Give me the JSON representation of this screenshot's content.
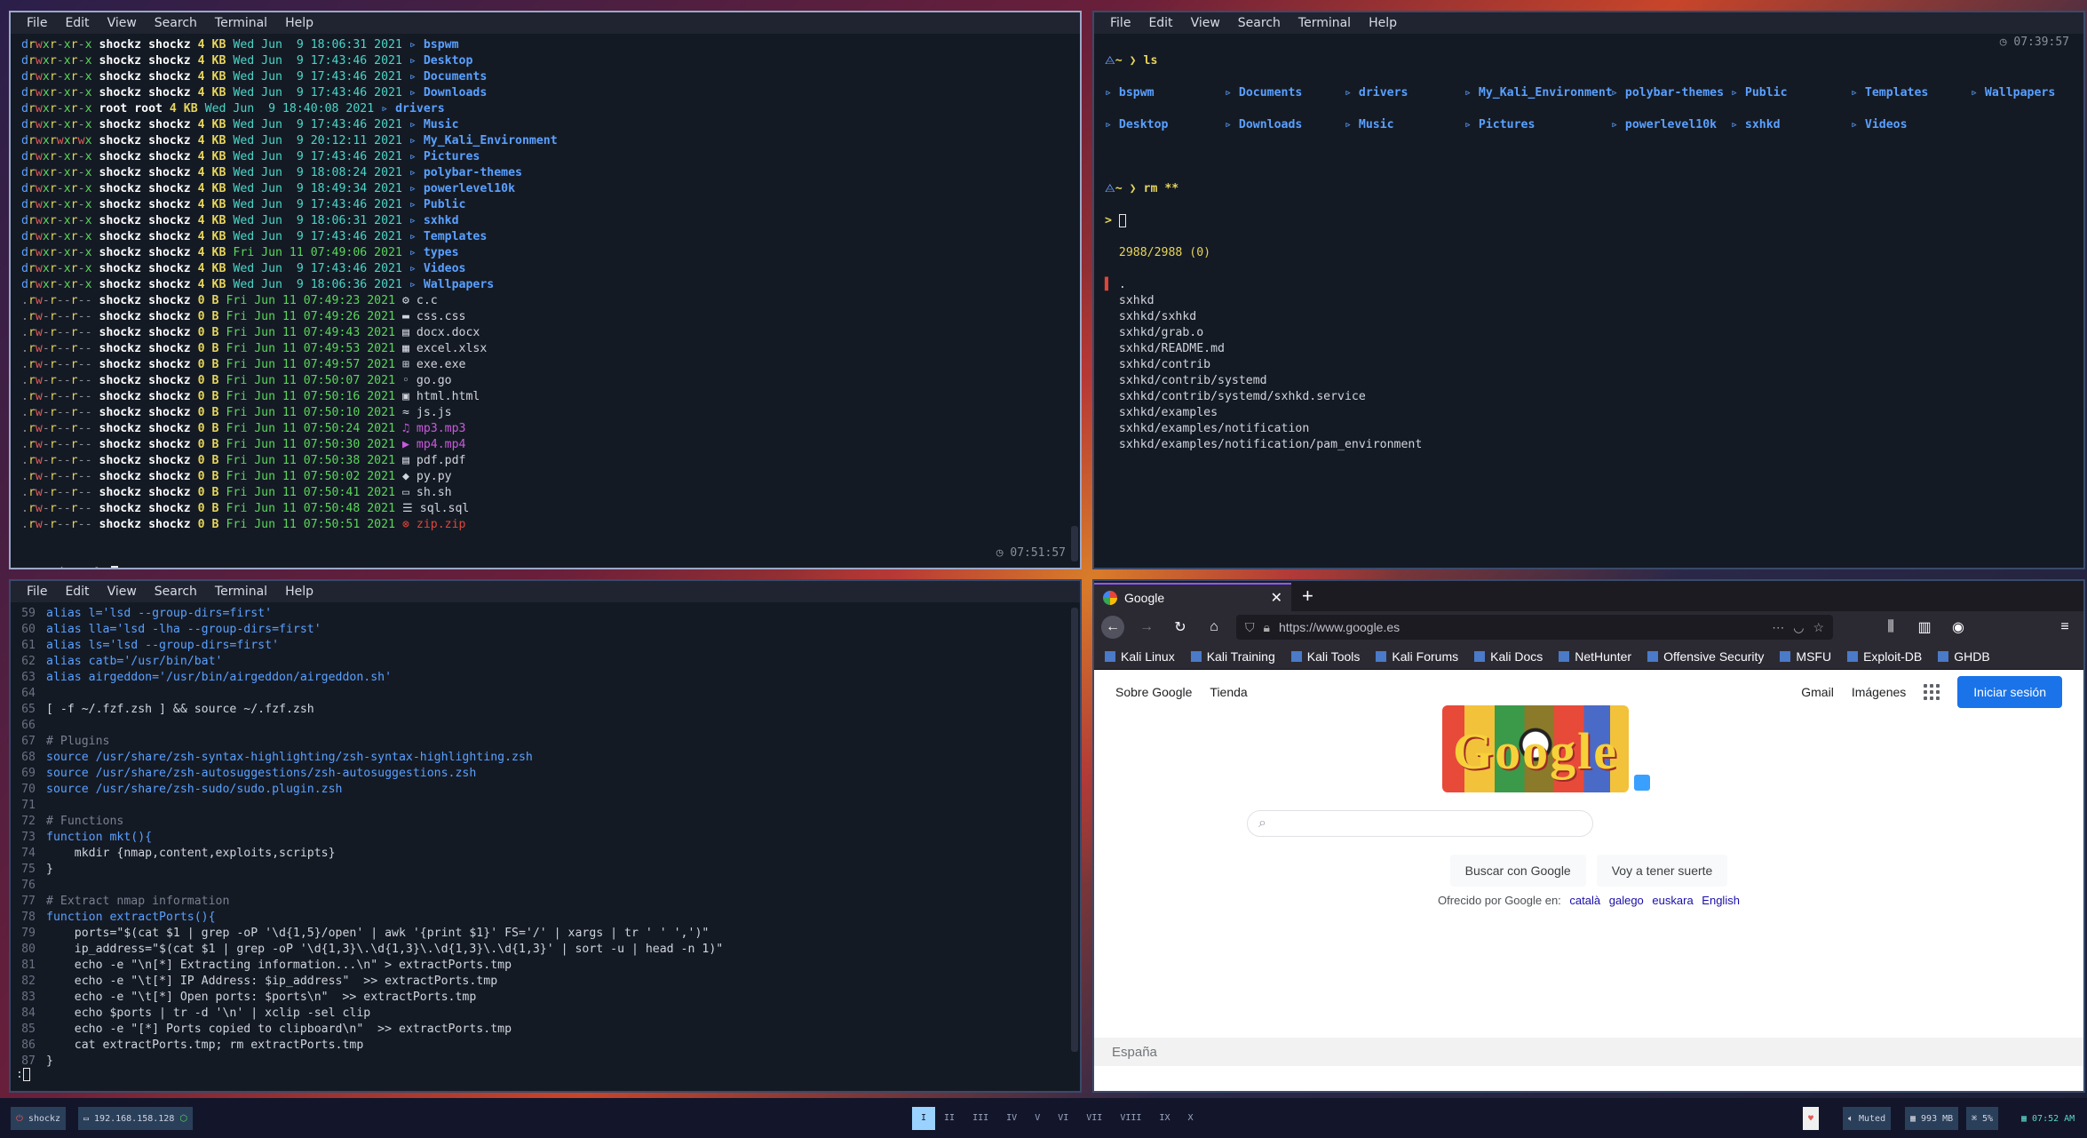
{
  "menus": [
    "File",
    "Edit",
    "View",
    "Search",
    "Terminal",
    "Help"
  ],
  "term1": {
    "rows": [
      {
        "perm": "drwxr-xr-x",
        "user": "shockz",
        "group": "shockz",
        "size": "4 KB",
        "date": "Wed Jun  9 18:06:31 2021",
        "icon": "▹",
        "name": "bspwm",
        "kind": "dir"
      },
      {
        "perm": "drwxr-xr-x",
        "user": "shockz",
        "group": "shockz",
        "size": "4 KB",
        "date": "Wed Jun  9 17:43:46 2021",
        "icon": "▹",
        "name": "Desktop",
        "kind": "dir"
      },
      {
        "perm": "drwxr-xr-x",
        "user": "shockz",
        "group": "shockz",
        "size": "4 KB",
        "date": "Wed Jun  9 17:43:46 2021",
        "icon": "▹",
        "name": "Documents",
        "kind": "dir"
      },
      {
        "perm": "drwxr-xr-x",
        "user": "shockz",
        "group": "shockz",
        "size": "4 KB",
        "date": "Wed Jun  9 17:43:46 2021",
        "icon": "▹",
        "name": "Downloads",
        "kind": "dir"
      },
      {
        "perm": "drwxr-xr-x",
        "user": "root",
        "group": "root",
        "size": "4 KB",
        "date": "Wed Jun  9 18:40:08 2021",
        "icon": "▹",
        "name": "drivers",
        "kind": "dir"
      },
      {
        "perm": "drwxr-xr-x",
        "user": "shockz",
        "group": "shockz",
        "size": "4 KB",
        "date": "Wed Jun  9 17:43:46 2021",
        "icon": "▹",
        "name": "Music",
        "kind": "dir"
      },
      {
        "perm": "drwxrwxrwx",
        "user": "shockz",
        "group": "shockz",
        "size": "4 KB",
        "date": "Wed Jun  9 20:12:11 2021",
        "icon": "▹",
        "name": "My_Kali_Environment",
        "kind": "dir"
      },
      {
        "perm": "drwxr-xr-x",
        "user": "shockz",
        "group": "shockz",
        "size": "4 KB",
        "date": "Wed Jun  9 17:43:46 2021",
        "icon": "▹",
        "name": "Pictures",
        "kind": "dir"
      },
      {
        "perm": "drwxr-xr-x",
        "user": "shockz",
        "group": "shockz",
        "size": "4 KB",
        "date": "Wed Jun  9 18:08:24 2021",
        "icon": "▹",
        "name": "polybar-themes",
        "kind": "dir"
      },
      {
        "perm": "drwxr-xr-x",
        "user": "shockz",
        "group": "shockz",
        "size": "4 KB",
        "date": "Wed Jun  9 18:49:34 2021",
        "icon": "▹",
        "name": "powerlevel10k",
        "kind": "dir"
      },
      {
        "perm": "drwxr-xr-x",
        "user": "shockz",
        "group": "shockz",
        "size": "4 KB",
        "date": "Wed Jun  9 17:43:46 2021",
        "icon": "▹",
        "name": "Public",
        "kind": "dir"
      },
      {
        "perm": "drwxr-xr-x",
        "user": "shockz",
        "group": "shockz",
        "size": "4 KB",
        "date": "Wed Jun  9 18:06:31 2021",
        "icon": "▹",
        "name": "sxhkd",
        "kind": "dir"
      },
      {
        "perm": "drwxr-xr-x",
        "user": "shockz",
        "group": "shockz",
        "size": "4 KB",
        "date": "Wed Jun  9 17:43:46 2021",
        "icon": "▹",
        "name": "Templates",
        "kind": "dir"
      },
      {
        "perm": "drwxr-xr-x",
        "user": "shockz",
        "group": "shockz",
        "size": "4 KB",
        "date": "Fri Jun 11 07:49:06 2021",
        "icon": "▹",
        "name": "types",
        "kind": "dir",
        "new": true
      },
      {
        "perm": "drwxr-xr-x",
        "user": "shockz",
        "group": "shockz",
        "size": "4 KB",
        "date": "Wed Jun  9 17:43:46 2021",
        "icon": "▹",
        "name": "Videos",
        "kind": "dir"
      },
      {
        "perm": "drwxr-xr-x",
        "user": "shockz",
        "group": "shockz",
        "size": "4 KB",
        "date": "Wed Jun  9 18:06:36 2021",
        "icon": "▹",
        "name": "Wallpapers",
        "kind": "dir"
      },
      {
        "perm": ".rw-r--r--",
        "user": "shockz",
        "group": "shockz",
        "size": "0 B",
        "date": "Fri Jun 11 07:49:23 2021",
        "icon": "⚙",
        "name": "c.c",
        "kind": "file",
        "new": true
      },
      {
        "perm": ".rw-r--r--",
        "user": "shockz",
        "group": "shockz",
        "size": "0 B",
        "date": "Fri Jun 11 07:49:26 2021",
        "icon": "▬",
        "name": "css.css",
        "kind": "file",
        "new": true
      },
      {
        "perm": ".rw-r--r--",
        "user": "shockz",
        "group": "shockz",
        "size": "0 B",
        "date": "Fri Jun 11 07:49:43 2021",
        "icon": "▤",
        "name": "docx.docx",
        "kind": "file",
        "new": true
      },
      {
        "perm": ".rw-r--r--",
        "user": "shockz",
        "group": "shockz",
        "size": "0 B",
        "date": "Fri Jun 11 07:49:53 2021",
        "icon": "▦",
        "name": "excel.xlsx",
        "kind": "file",
        "new": true
      },
      {
        "perm": ".rw-r--r--",
        "user": "shockz",
        "group": "shockz",
        "size": "0 B",
        "date": "Fri Jun 11 07:49:57 2021",
        "icon": "⊞",
        "name": "exe.exe",
        "kind": "file",
        "new": true
      },
      {
        "perm": ".rw-r--r--",
        "user": "shockz",
        "group": "shockz",
        "size": "0 B",
        "date": "Fri Jun 11 07:50:07 2021",
        "icon": "◦",
        "name": "go.go",
        "kind": "file",
        "new": true
      },
      {
        "perm": ".rw-r--r--",
        "user": "shockz",
        "group": "shockz",
        "size": "0 B",
        "date": "Fri Jun 11 07:50:16 2021",
        "icon": "▣",
        "name": "html.html",
        "kind": "file",
        "new": true
      },
      {
        "perm": ".rw-r--r--",
        "user": "shockz",
        "group": "shockz",
        "size": "0 B",
        "date": "Fri Jun 11 07:50:10 2021",
        "icon": "≈",
        "name": "js.js",
        "kind": "file",
        "new": true
      },
      {
        "perm": ".rw-r--r--",
        "user": "shockz",
        "group": "shockz",
        "size": "0 B",
        "date": "Fri Jun 11 07:50:24 2021",
        "icon": "♫",
        "name": "mp3.mp3",
        "kind": "media",
        "new": true
      },
      {
        "perm": ".rw-r--r--",
        "user": "shockz",
        "group": "shockz",
        "size": "0 B",
        "date": "Fri Jun 11 07:50:30 2021",
        "icon": "▶",
        "name": "mp4.mp4",
        "kind": "media",
        "new": true
      },
      {
        "perm": ".rw-r--r--",
        "user": "shockz",
        "group": "shockz",
        "size": "0 B",
        "date": "Fri Jun 11 07:50:38 2021",
        "icon": "▤",
        "name": "pdf.pdf",
        "kind": "file",
        "new": true
      },
      {
        "perm": ".rw-r--r--",
        "user": "shockz",
        "group": "shockz",
        "size": "0 B",
        "date": "Fri Jun 11 07:50:02 2021",
        "icon": "◆",
        "name": "py.py",
        "kind": "file",
        "new": true
      },
      {
        "perm": ".rw-r--r--",
        "user": "shockz",
        "group": "shockz",
        "size": "0 B",
        "date": "Fri Jun 11 07:50:41 2021",
        "icon": "▭",
        "name": "sh.sh",
        "kind": "file",
        "new": true
      },
      {
        "perm": ".rw-r--r--",
        "user": "shockz",
        "group": "shockz",
        "size": "0 B",
        "date": "Fri Jun 11 07:50:48 2021",
        "icon": "☰",
        "name": "sql.sql",
        "kind": "file",
        "new": true
      },
      {
        "perm": ".rw-r--r--",
        "user": "shockz",
        "group": "shockz",
        "size": "0 B",
        "date": "Fri Jun 11 07:50:51 2021",
        "icon": "⊗",
        "name": "zip.zip",
        "kind": "archive",
        "new": true
      }
    ],
    "clock": "07:51:57",
    "prompt": "~ ❯"
  },
  "term2": {
    "clock": "07:39:57",
    "prompt_ls": "~ ❯ ls",
    "ls_row1": [
      "bspwm",
      "Documents",
      "drivers",
      "My_Kali_Environment",
      "polybar-themes",
      "Public",
      "Templates",
      "Wallpapers"
    ],
    "ls_row2": [
      "Desktop",
      "Downloads",
      "Music",
      "Pictures",
      "powerlevel10k",
      "sxhkd",
      "Videos"
    ],
    "prompt_rm": "~ ❯ rm **",
    "fzf_prompt": ">",
    "count": "2988/2988 (0)",
    "results": [
      ".",
      "sxhkd",
      "sxhkd/sxhkd",
      "sxhkd/grab.o",
      "sxhkd/README.md",
      "sxhkd/contrib",
      "sxhkd/contrib/systemd",
      "sxhkd/contrib/systemd/sxhkd.service",
      "sxhkd/examples",
      "sxhkd/examples/notification",
      "sxhkd/examples/notification/pam_environment"
    ]
  },
  "term3": {
    "lines": [
      {
        "n": "59",
        "t": "alias l='lsd --group-dirs=first'"
      },
      {
        "n": "60",
        "t": "alias lla='lsd -lha --group-dirs=first'"
      },
      {
        "n": "61",
        "t": "alias ls='lsd --group-dirs=first'"
      },
      {
        "n": "62",
        "t": "alias catb='/usr/bin/bat'"
      },
      {
        "n": "63",
        "t": "alias airgeddon='/usr/bin/airgeddon/airgeddon.sh'"
      },
      {
        "n": "64",
        "t": ""
      },
      {
        "n": "65",
        "t": "[ -f ~/.fzf.zsh ] && source ~/.fzf.zsh"
      },
      {
        "n": "66",
        "t": ""
      },
      {
        "n": "67",
        "t": "# Plugins"
      },
      {
        "n": "68",
        "t": "source /usr/share/zsh-syntax-highlighting/zsh-syntax-highlighting.zsh"
      },
      {
        "n": "69",
        "t": "source /usr/share/zsh-autosuggestions/zsh-autosuggestions.zsh"
      },
      {
        "n": "70",
        "t": "source /usr/share/zsh-sudo/sudo.plugin.zsh"
      },
      {
        "n": "71",
        "t": ""
      },
      {
        "n": "72",
        "t": "# Functions"
      },
      {
        "n": "73",
        "t": "function mkt(){"
      },
      {
        "n": "74",
        "t": "    mkdir {nmap,content,exploits,scripts}"
      },
      {
        "n": "75",
        "t": "}"
      },
      {
        "n": "76",
        "t": ""
      },
      {
        "n": "77",
        "t": "# Extract nmap information"
      },
      {
        "n": "78",
        "t": "function extractPorts(){"
      },
      {
        "n": "79",
        "t": "    ports=\"$(cat $1 | grep -oP '\\d{1,5}/open' | awk '{print $1}' FS='/' | xargs | tr ' ' ',')\""
      },
      {
        "n": "80",
        "t": "    ip_address=\"$(cat $1 | grep -oP '\\d{1,3}\\.\\d{1,3}\\.\\d{1,3}\\.\\d{1,3}' | sort -u | head -n 1)\""
      },
      {
        "n": "81",
        "t": "    echo -e \"\\n[*] Extracting information...\\n\" > extractPorts.tmp"
      },
      {
        "n": "82",
        "t": "    echo -e \"\\t[*] IP Address: $ip_address\"  >> extractPorts.tmp"
      },
      {
        "n": "83",
        "t": "    echo -e \"\\t[*] Open ports: $ports\\n\"  >> extractPorts.tmp"
      },
      {
        "n": "84",
        "t": "    echo $ports | tr -d '\\n' | xclip -sel clip"
      },
      {
        "n": "85",
        "t": "    echo -e \"[*] Ports copied to clipboard\\n\"  >> extractPorts.tmp"
      },
      {
        "n": "86",
        "t": "    cat extractPorts.tmp; rm extractPorts.tmp"
      },
      {
        "n": "87",
        "t": "}"
      }
    ],
    "mode": ":"
  },
  "browser": {
    "tab_title": "Google",
    "url": "https://www.google.es",
    "bookmarks": [
      "Kali Linux",
      "Kali Training",
      "Kali Tools",
      "Kali Forums",
      "Kali Docs",
      "NetHunter",
      "Offensive Security",
      "MSFU",
      "Exploit-DB",
      "GHDB"
    ],
    "top_left": [
      "Sobre Google",
      "Tienda"
    ],
    "gmail": "Gmail",
    "images": "Imágenes",
    "signin": "Iniciar sesión",
    "doodle_text": "Google",
    "btn_search": "Buscar con Google",
    "btn_lucky": "Voy a tener suerte",
    "offered": "Ofrecido por Google en:",
    "languages": [
      "català",
      "galego",
      "euskara",
      "English"
    ],
    "footer": "España"
  },
  "taskbar": {
    "user": "shockz",
    "ip": "192.168.158.128",
    "workspaces": [
      "I",
      "II",
      "III",
      "IV",
      "V",
      "VI",
      "VII",
      "VIII",
      "IX",
      "X"
    ],
    "muted": "Muted",
    "memory": "993 MB",
    "cpu": "5%",
    "time": "07:52 AM"
  }
}
